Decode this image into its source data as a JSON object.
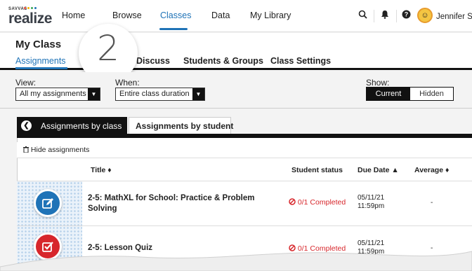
{
  "brand": {
    "small": "SAVVAS",
    "name": "realize"
  },
  "nav": {
    "links": [
      "Home",
      "Browse",
      "Classes",
      "Data",
      "My Library"
    ],
    "active": "Classes",
    "user": "Jennifer S."
  },
  "icons": [
    "search-icon",
    "bell-icon",
    "help-icon",
    "avatar"
  ],
  "class_header": {
    "title": "My Class",
    "tabs": [
      "Assignments",
      "Discuss",
      "Students & Groups",
      "Class Settings"
    ],
    "active_tab": "Assignments",
    "callout_number": "2"
  },
  "filters": {
    "view_label": "View:",
    "view_value": "All my assignments",
    "when_label": "When:",
    "when_value": "Entire class duration",
    "show_label": "Show:",
    "show_options": [
      "Current",
      "Hidden"
    ],
    "show_selected": "Current"
  },
  "list": {
    "subtabs": [
      "Assignments by class",
      "Assignments by student"
    ],
    "active_subtab": "Assignments by class",
    "hide_label": "Hide assignments",
    "columns": [
      "Title ♦",
      "Student status",
      "Due Date ▲",
      "Average ♦"
    ],
    "rows": [
      {
        "title": "2-5: MathXL for School: Practice & Problem Solving",
        "status": "0/1 Completed",
        "due_date": "05/11/21",
        "due_time": "11:59pm",
        "average": "-",
        "icon": "edit-icon",
        "icon_color": "#1f73b7"
      },
      {
        "title": "2-5: Lesson Quiz",
        "status": "0/1 Completed",
        "due_date": "05/11/21",
        "due_time": "11:59pm",
        "average": "-",
        "icon": "checkbox-icon",
        "icon_color": "#d7262b"
      }
    ]
  },
  "colors": {
    "accent": "#1f73b7",
    "status_red": "#d7262b",
    "dark": "#111111"
  }
}
